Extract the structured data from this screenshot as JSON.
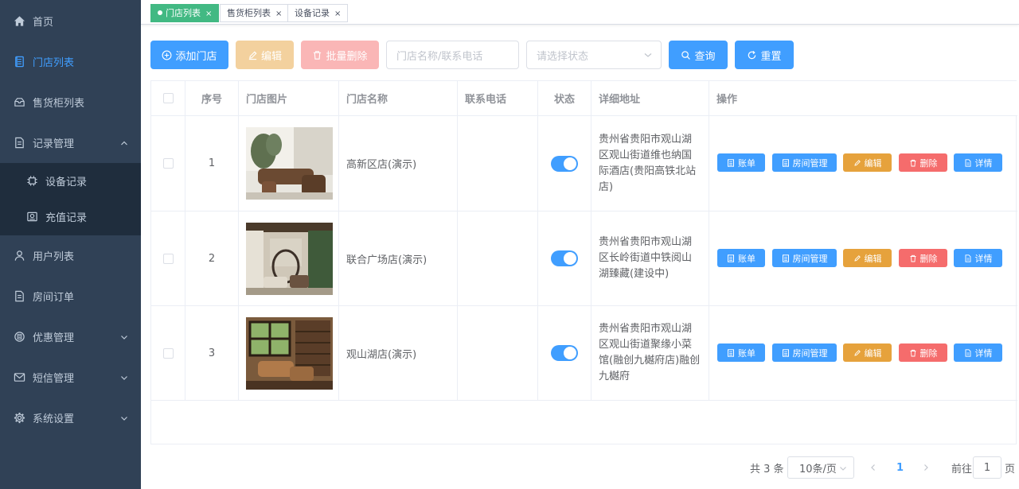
{
  "sidebar": {
    "items": [
      {
        "label": "首页",
        "icon": "home-icon"
      },
      {
        "label": "门店列表",
        "icon": "document-icon",
        "active": true
      },
      {
        "label": "售货柜列表",
        "icon": "cabinet-icon"
      },
      {
        "label": "记录管理",
        "icon": "file-icon",
        "expanded": true
      },
      {
        "label": "用户列表",
        "icon": "user-icon"
      },
      {
        "label": "房间订单",
        "icon": "file-icon"
      },
      {
        "label": "优惠管理",
        "icon": "coupon-icon"
      },
      {
        "label": "短信管理",
        "icon": "mail-icon"
      },
      {
        "label": "系统设置",
        "icon": "gear-icon"
      }
    ],
    "sub_items": [
      {
        "label": "设备记录",
        "icon": "chip-icon"
      },
      {
        "label": "充值记录",
        "icon": "recharge-icon"
      }
    ]
  },
  "tags": [
    {
      "label": "门店列表",
      "active": true
    },
    {
      "label": "售货柜列表"
    },
    {
      "label": "设备记录"
    }
  ],
  "toolbar": {
    "add_label": "添加门店",
    "edit_label": "编辑",
    "batch_delete_label": "批量删除",
    "search_placeholder": "门店名称/联系电话",
    "status_placeholder": "请选择状态",
    "query_label": "查询",
    "reset_label": "重置"
  },
  "table": {
    "headers": [
      "序号",
      "门店图片",
      "门店名称",
      "联系电话",
      "状态",
      "详细地址",
      "操作"
    ],
    "rows": [
      {
        "index": "1",
        "name": "高新区店(演示)",
        "phone": "",
        "status_on": true,
        "address": "贵州省贵阳市观山湖区观山街道维也纳国际酒店(贵阳高铁北站店)"
      },
      {
        "index": "2",
        "name": "联合广场店(演示)",
        "phone": "",
        "status_on": true,
        "address": "贵州省贵阳市观山湖区长岭街道中铁阅山湖臻藏(建设中)"
      },
      {
        "index": "3",
        "name": "观山湖店(演示)",
        "phone": "",
        "status_on": true,
        "address": "贵州省贵阳市观山湖区观山街道聚缘小菜馆(融创九樾府店)融创九樾府"
      }
    ],
    "actions": [
      "账单",
      "房间管理",
      "编辑",
      "删除",
      "详情"
    ]
  },
  "pagination": {
    "total": "共 3 条",
    "page_size": "10条/页",
    "current_page": "1",
    "goto_prefix": "前往",
    "goto_value": "1",
    "goto_suffix": "页"
  },
  "colors": {
    "sidebar_bg": "#304156",
    "primary": "#409eff",
    "success": "#42b983",
    "warning": "#e6a23c",
    "danger": "#f56c6c"
  }
}
